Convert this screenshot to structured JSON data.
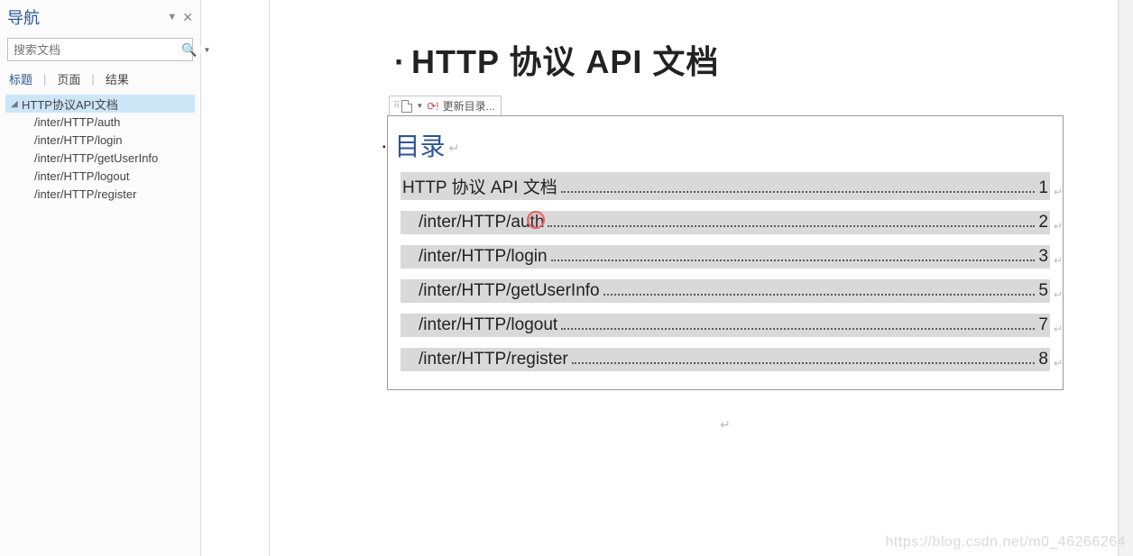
{
  "nav": {
    "title": "导航",
    "search_placeholder": "搜索文档",
    "tabs": {
      "headings": "标题",
      "pages": "页面",
      "results": "结果"
    },
    "tree": {
      "root": "HTTP协议API文档",
      "children": [
        "/inter/HTTP/auth",
        "/inter/HTTP/login",
        "/inter/HTTP/getUserInfo",
        "/inter/HTTP/logout",
        "/inter/HTTP/register"
      ]
    }
  },
  "doc": {
    "title": "HTTP 协议 API 文档",
    "toc_tab": {
      "update_label": "更新目录..."
    },
    "toc_heading": "目录",
    "entries": [
      {
        "text": "HTTP 协议 API 文档",
        "page": "1",
        "level": 0
      },
      {
        "text": "/inter/HTTP/auth",
        "page": "2",
        "level": 1
      },
      {
        "text": "/inter/HTTP/login",
        "page": "3",
        "level": 1
      },
      {
        "text": "/inter/HTTP/getUserInfo",
        "page": "5",
        "level": 1
      },
      {
        "text": "/inter/HTTP/logout",
        "page": "7",
        "level": 1
      },
      {
        "text": "/inter/HTTP/register",
        "page": "8",
        "level": 1
      }
    ]
  },
  "watermark": "https://blog.csdn.net/m0_46266264"
}
